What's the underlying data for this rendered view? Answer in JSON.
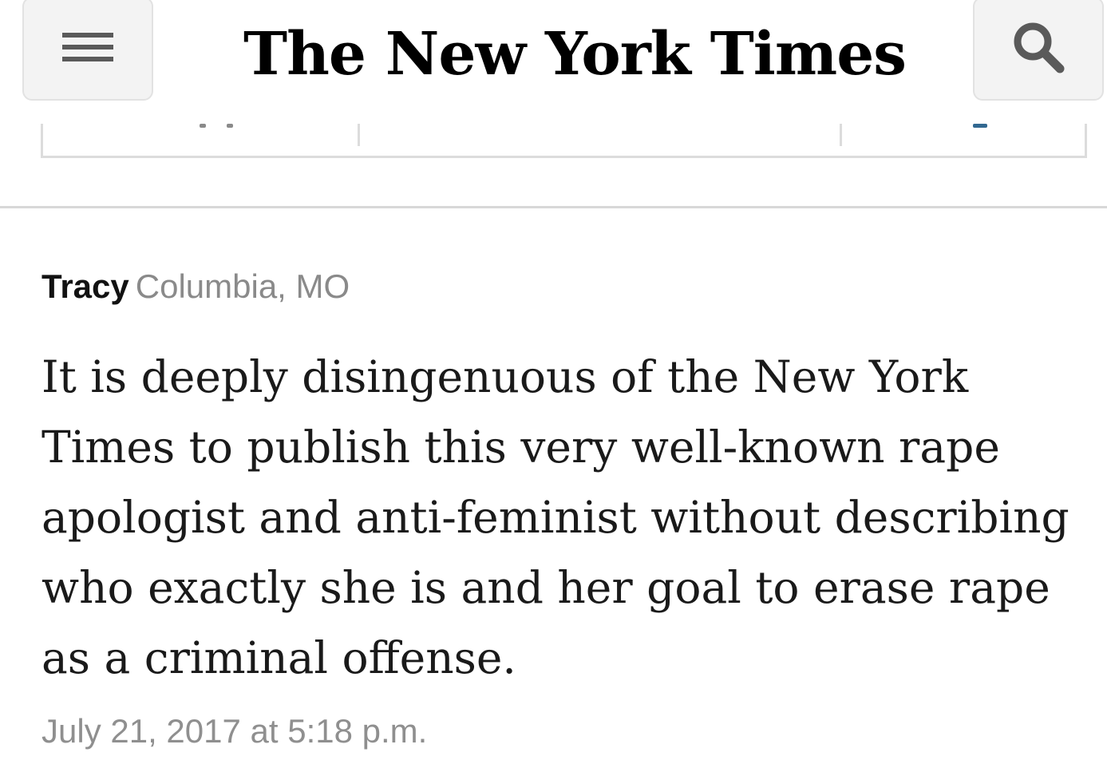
{
  "header": {
    "masthead": "The New York Times",
    "menu_icon": "hamburger-menu-icon",
    "search_icon": "search-icon"
  },
  "comment": {
    "author": "Tracy",
    "location": "Columbia, MO",
    "body": "It is deeply disingenuous of the New York Times to publish this very well-known rape apologist and anti-feminist without describing who exactly she is and her goal to erase rape as a criminal offense.",
    "date": "July 21, 2017 at 5:18 p.m."
  },
  "colors": {
    "author": "#121212",
    "meta_gray": "#8a8a8a",
    "button_bg": "#f3f3f3",
    "rule": "#d8d8d8"
  }
}
